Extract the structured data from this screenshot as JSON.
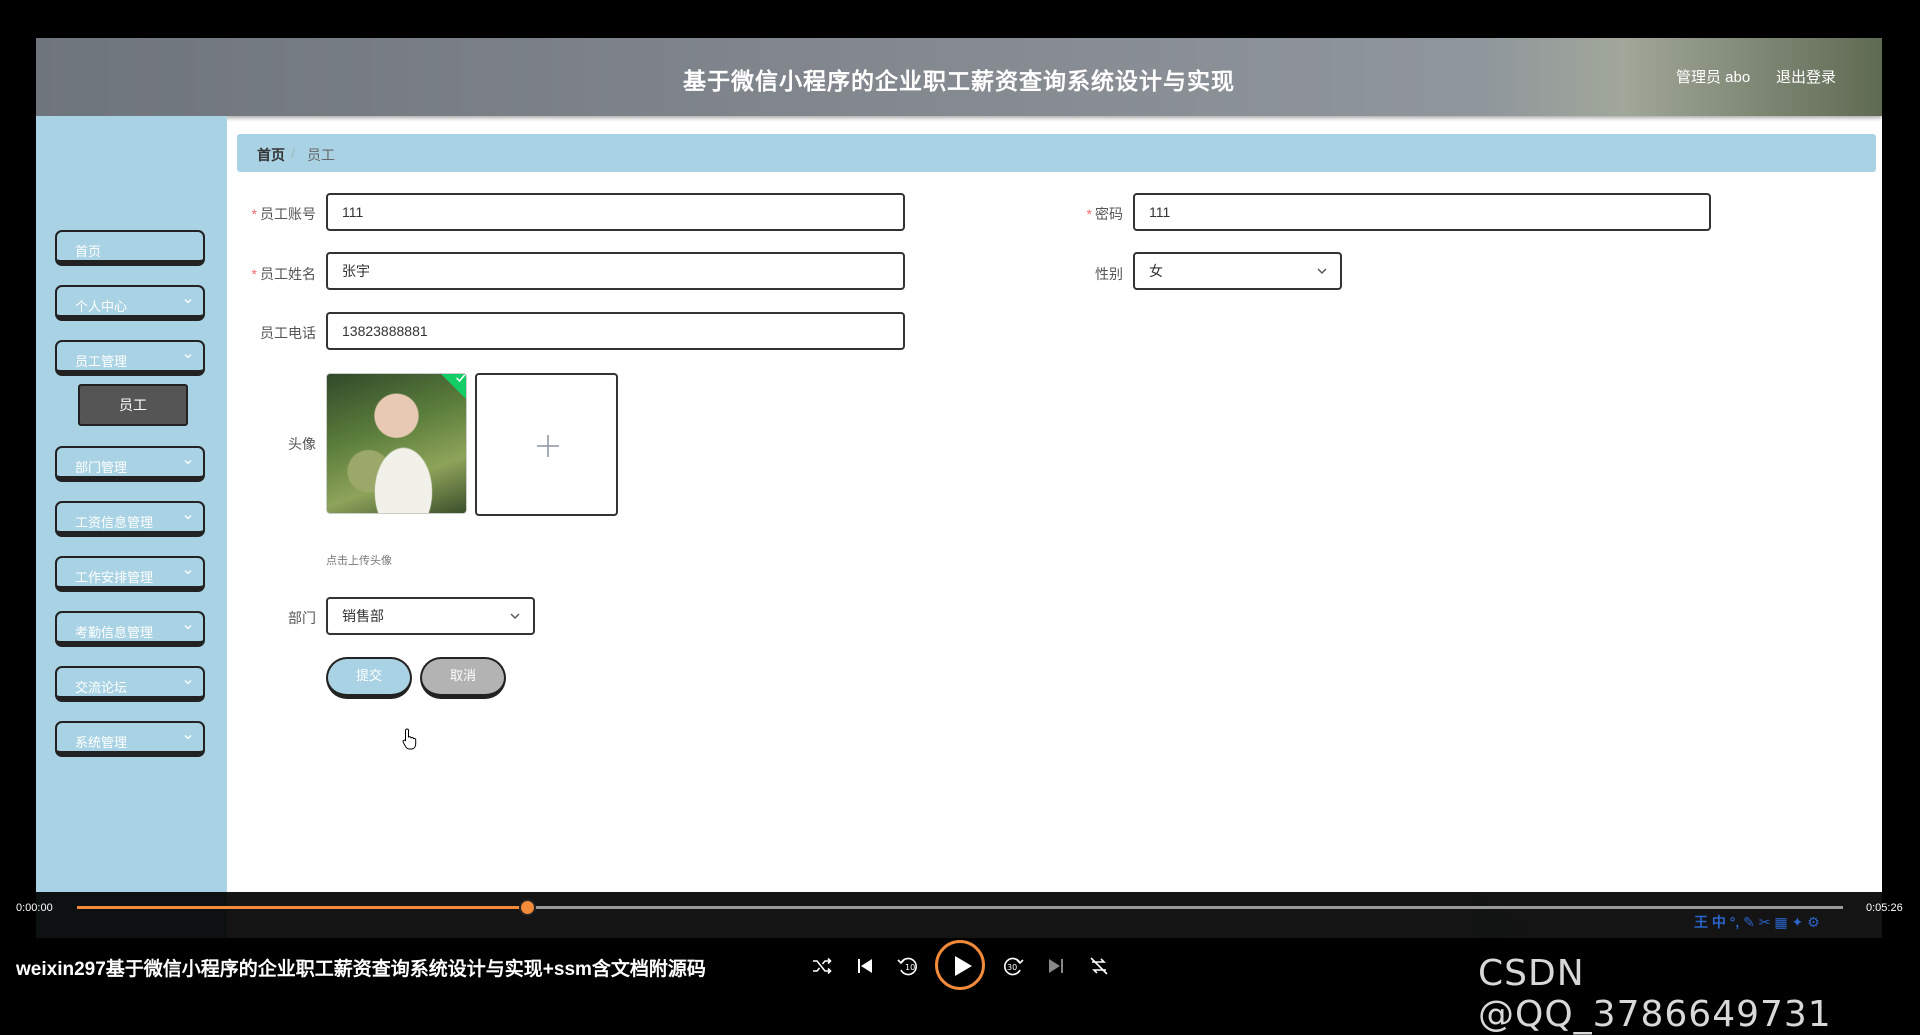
{
  "header": {
    "title": "基于微信小程序的企业职工薪资查询系统设计与实现",
    "user": "管理员 abo",
    "logout": "退出登录"
  },
  "sidebar": {
    "items": [
      {
        "label": "首页"
      },
      {
        "label": "个人中心"
      },
      {
        "label": "员工管理"
      },
      {
        "label": "部门管理"
      },
      {
        "label": "工资信息管理"
      },
      {
        "label": "工作安排管理"
      },
      {
        "label": "考勤信息管理"
      },
      {
        "label": "交流论坛"
      },
      {
        "label": "系统管理"
      }
    ],
    "sub_item": "员工"
  },
  "breadcrumb": {
    "home": "首页",
    "separator": "/",
    "current": "员工"
  },
  "form": {
    "account": {
      "label": "员工账号",
      "value": "111"
    },
    "password": {
      "label": "密码",
      "value": "111"
    },
    "name": {
      "label": "员工姓名",
      "value": "张宇"
    },
    "gender": {
      "label": "性别",
      "value": "女"
    },
    "phone": {
      "label": "员工电话",
      "value": "13823888881"
    },
    "avatar": {
      "label": "头像",
      "hint": "点击上传头像"
    },
    "department": {
      "label": "部门",
      "value": "销售部"
    },
    "required_mark": "*",
    "submit": "提交",
    "cancel": "取消"
  },
  "video": {
    "title": "weixin297基于微信小程序的企业职工薪资查询系统设计与实现+ssm含文档附源码",
    "time_current": "0:00:00",
    "time_total": "0:05:26",
    "progress": 0.255,
    "accent": "#f28a3a"
  },
  "ime": "王 中 °, ✎ ✂ ▦ ✦ ⚙",
  "watermark": "CSDN @QQ_3786649731",
  "colors": {
    "sidebar_bg": "#a9d3e4",
    "submit_bg": "#a9d3e4",
    "cancel_bg": "#b3b3b3",
    "required": "#f56c6c"
  }
}
